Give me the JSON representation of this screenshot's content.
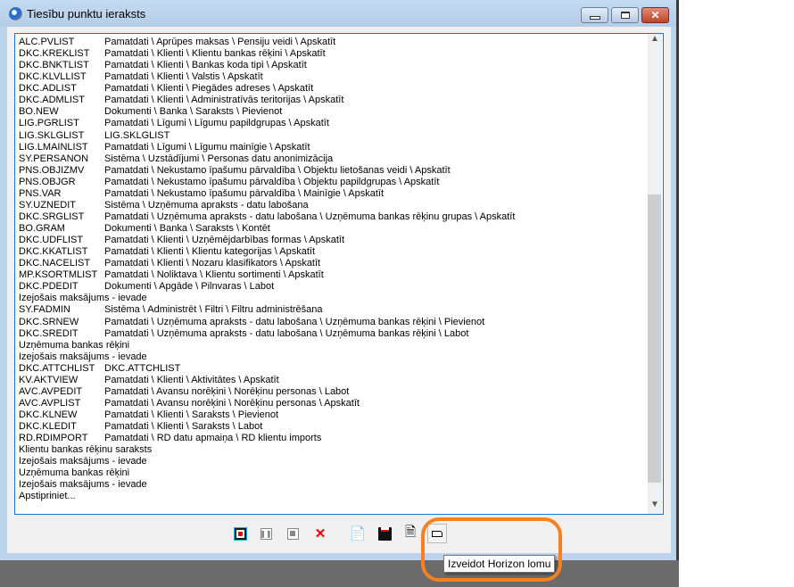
{
  "window": {
    "title": "Tiesību punktu ieraksts",
    "icon": "app-globe-icon"
  },
  "list": [
    [
      "ALC.PVLIST",
      "Pamatdati \\ Aprūpes maksas \\ Pensiju veidi \\ Apskatīt"
    ],
    [
      "DKC.KREKLIST",
      "Pamatdati \\ Klienti \\ Klientu bankas rēķini \\ Apskatīt"
    ],
    [
      "DKC.BNKTLIST",
      "Pamatdati \\ Klienti \\ Bankas koda tipi \\ Apskatīt"
    ],
    [
      "DKC.KLVLLIST",
      "Pamatdati \\ Klienti \\ Valstis \\ Apskatīt"
    ],
    [
      "DKC.ADLIST",
      "Pamatdati \\ Klienti \\ Piegādes adreses \\ Apskatīt"
    ],
    [
      "DKC.ADMLIST",
      "Pamatdati \\ Klienti \\ Administratīvās teritorijas \\ Apskatīt"
    ],
    [
      "BO.NEW",
      "Dokumenti \\ Banka \\ Saraksts \\ Pievienot"
    ],
    [
      "LIG.PGRLIST",
      "Pamatdati \\ Līgumi \\ Līgumu papildgrupas \\ Apskatīt"
    ],
    [
      "LIG.SKLGLIST",
      "LIG.SKLGLIST"
    ],
    [
      "LIG.LMAINLIST",
      "Pamatdati \\ Līgumi \\ Līgumu mainīgie \\ Apskatīt"
    ],
    [
      "SY.PERSANON",
      "Sistēma \\ Uzstādījumi \\ Personas datu anonimizācija"
    ],
    [
      "PNS.OBJIZMV",
      "Pamatdati \\ Nekustamo īpašumu pārvaldība \\ Objektu lietošanas veidi \\ Apskatīt"
    ],
    [
      "PNS.OBJGR",
      "Pamatdati \\ Nekustamo īpašumu pārvaldība \\ Objektu papildgrupas \\ Apskatīt"
    ],
    [
      "PNS.VAR",
      "Pamatdati \\ Nekustamo īpašumu pārvaldība \\ Mainīgie \\ Apskatīt"
    ],
    [
      "SY.UZNEDIT",
      "Sistēma \\ Uzņēmuma apraksts - datu labošana"
    ],
    [
      "DKC.SRGLIST",
      "Pamatdati \\ Uzņēmuma apraksts - datu labošana \\ Uzņēmuma bankas rēķinu grupas \\ Apskatīt"
    ],
    [
      "BO.GRAM",
      "Dokumenti \\ Banka \\ Saraksts \\ Kontēt"
    ],
    [
      "DKC.UDFLIST",
      "Pamatdati \\ Klienti \\ Uzņēmējdarbības formas \\ Apskatīt"
    ],
    [
      "DKC.KKATLIST",
      "Pamatdati \\ Klienti \\ Klientu kategorijas \\ Apskatīt"
    ],
    [
      "DKC.NACELIST",
      "Pamatdati \\ Klienti \\ Nozaru klasifikators \\ Apskatīt"
    ],
    [
      "MP.KSORTMLIST",
      "Pamatdati \\ Noliktava \\ Klientu sortimenti \\ Apskatīt"
    ],
    [
      "DKC.PDEDIT",
      "Dokumenti \\ Apgāde \\ Pilnvaras \\ Labot"
    ],
    [
      "Izejošais maksājums - ievade",
      ""
    ],
    [
      "SY.FADMIN",
      "Sistēma \\ Administrēt \\ Filtri \\ Filtru administrēšana"
    ],
    [
      "DKC.SRNEW",
      "Pamatdati \\ Uzņēmuma apraksts - datu labošana \\ Uzņēmuma bankas rēķini \\ Pievienot"
    ],
    [
      "DKC.SREDIT",
      "Pamatdati \\ Uzņēmuma apraksts - datu labošana \\ Uzņēmuma bankas rēķini \\ Labot"
    ],
    [
      "Uzņēmuma bankas rēķini",
      ""
    ],
    [
      "Izejošais maksājums - ievade",
      ""
    ],
    [
      "DKC.ATTCHLIST",
      "DKC.ATTCHLIST"
    ],
    [
      "KV.AKTVIEW",
      "Pamatdati \\ Klienti \\ Aktivitātes \\ Apskatīt"
    ],
    [
      "AVC.AVPEDIT",
      "Pamatdati \\ Avansu norēķini \\ Norēķinu personas \\ Labot"
    ],
    [
      "AVC.AVPLIST",
      "Pamatdati \\ Avansu norēķini \\ Norēķinu personas \\ Apskatīt"
    ],
    [
      "DKC.KLNEW",
      "Pamatdati \\ Klienti \\ Saraksts \\ Pievienot"
    ],
    [
      "DKC.KLEDIT",
      "Pamatdati \\ Klienti \\ Saraksts \\ Labot"
    ],
    [
      "RD.RDIMPORT",
      "Pamatdati \\ RD datu apmaiņa \\ RD klientu imports"
    ],
    [
      "Klientu bankas rēķinu saraksts",
      ""
    ],
    [
      "Izejošais maksājums - ievade",
      ""
    ],
    [
      "Uzņēmuma bankas rēķini",
      ""
    ],
    [
      "Izejošais maksājums - ievade",
      ""
    ],
    [
      "Apstipriniet...",
      ""
    ]
  ],
  "toolbar": {
    "buttons": [
      "record-icon",
      "pause-icon",
      "stop-icon",
      "delete-icon",
      "export-icon",
      "save-icon",
      "document-icon",
      "create-role-icon"
    ],
    "tooltip": "Izveidot Horizon lomu"
  },
  "colors": {
    "highlight": "#f58220",
    "list_border": "#1878d0"
  }
}
